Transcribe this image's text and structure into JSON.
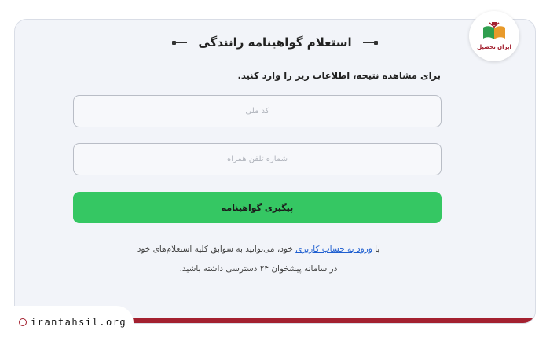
{
  "form": {
    "title": "استعلام گواهینامه رانندگی",
    "subtitle": "برای مشاهده نتیجه، اطلاعات زیر را وارد کنید.",
    "national_code_placeholder": "کد ملی",
    "phone_placeholder": "شماره تلفن همراه",
    "submit_label": "پیگیری گواهینامه"
  },
  "info": {
    "prefix": "با",
    "link_text": "ورود به حساب کاربری",
    "suffix": "خود، می‌توانید به سوابق کلیه استعلام‌های خود",
    "line2": "در سامانه پیشخوان ۲۴ دسترسی داشته باشید."
  },
  "branding": {
    "logo_text": "ایران تحصیل",
    "site": "irantahsil.org"
  },
  "colors": {
    "accent_green": "#35c763",
    "brand_red": "#a3202f",
    "link_blue": "#1f5fd0"
  }
}
